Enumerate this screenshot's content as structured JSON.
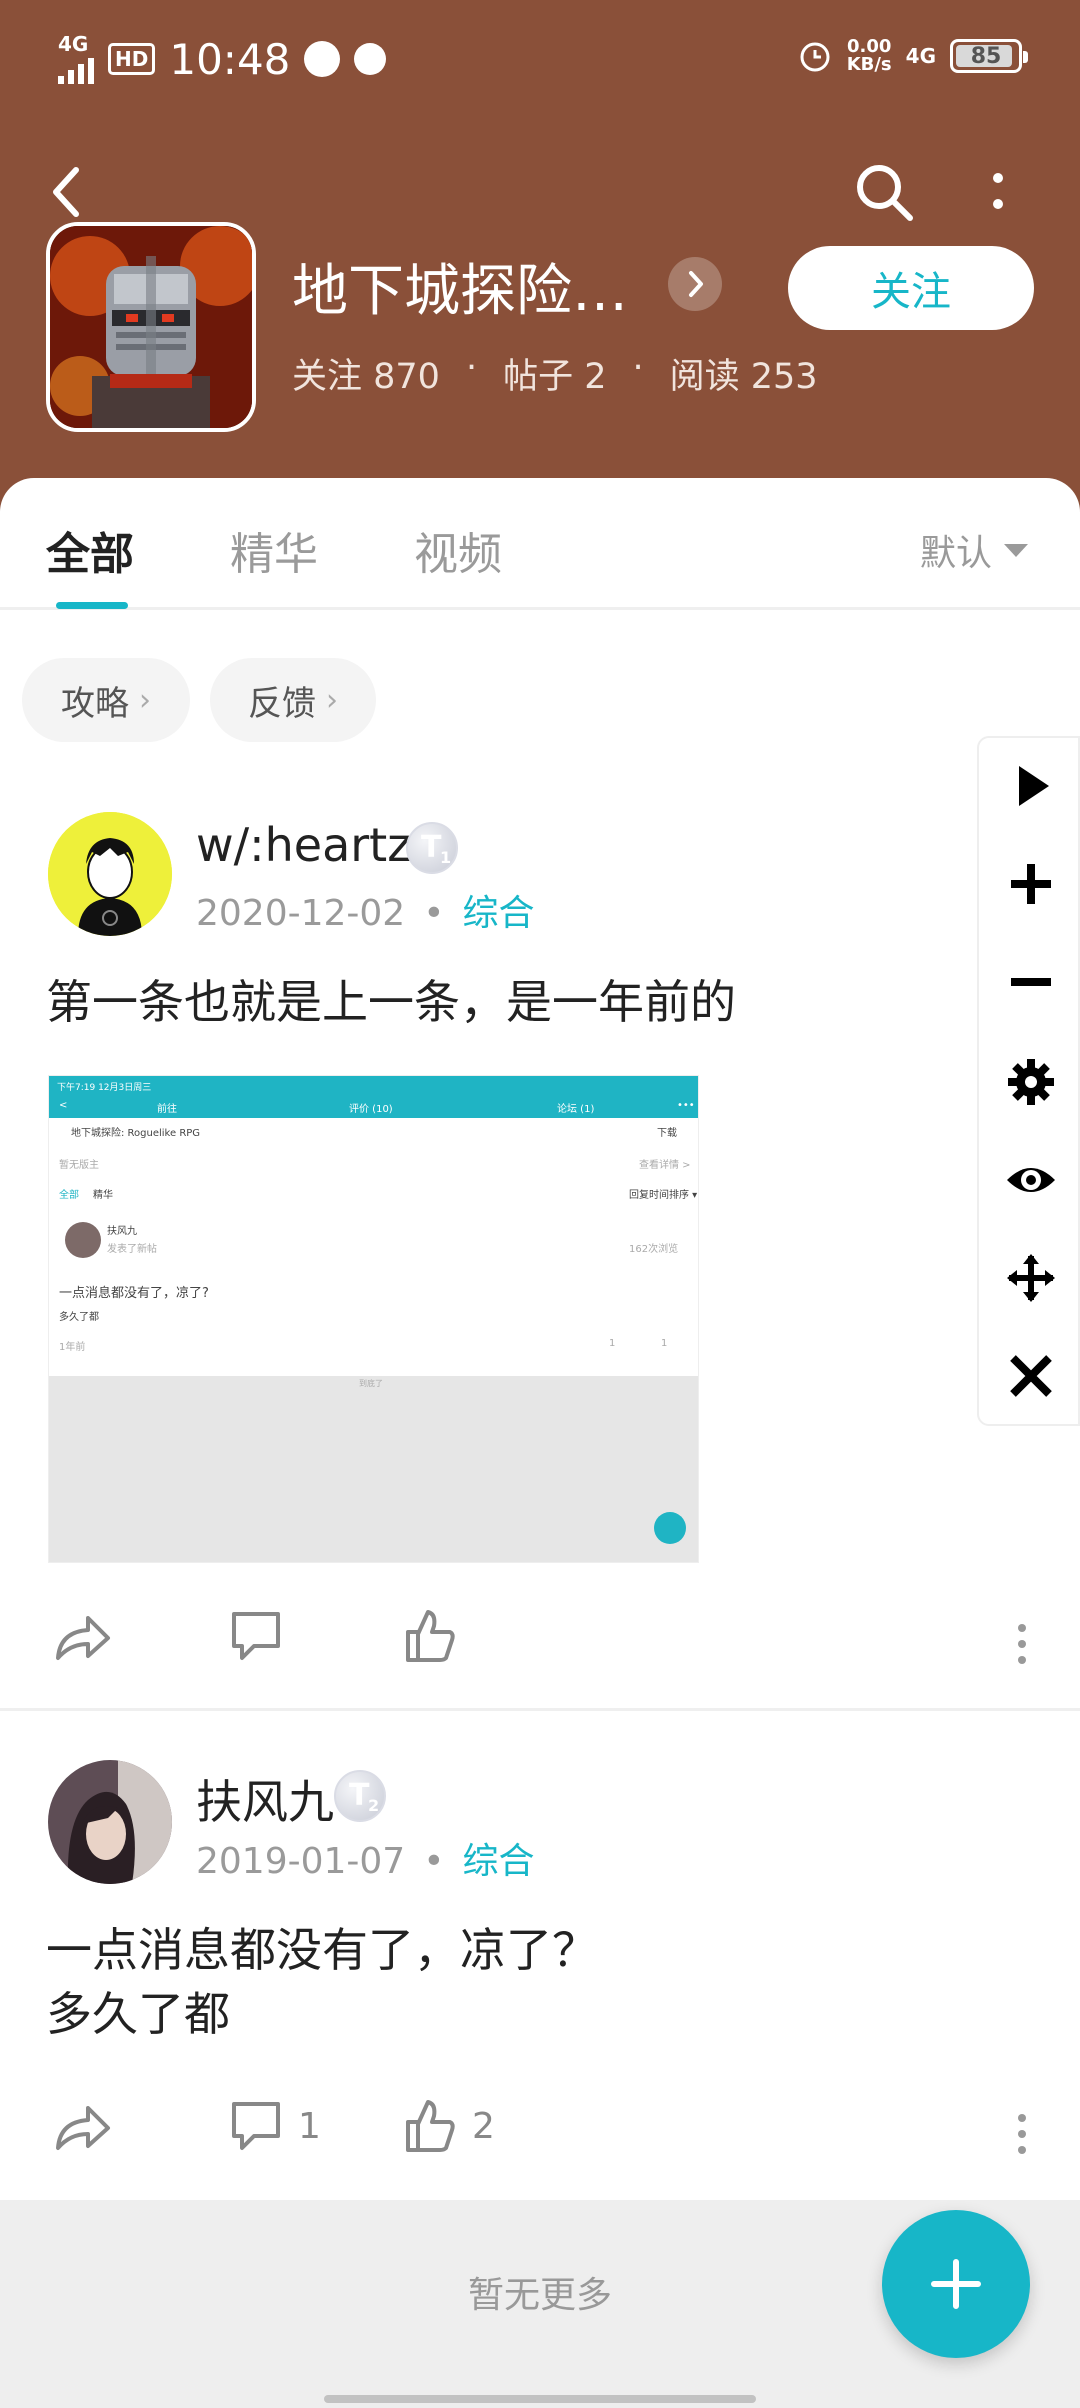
{
  "status_bar": {
    "network": "4G",
    "hd": "HD",
    "time": "10:48",
    "net_speed_value": "0.00",
    "net_speed_unit": "KB/s",
    "network_right": "4G",
    "battery": "85"
  },
  "forum": {
    "title": "地下城探险…",
    "follow_label": "关注",
    "stats": {
      "followers_label": "关注 870",
      "posts_label": "帖子 2",
      "reads_label": "阅读 253",
      "separator": "·"
    }
  },
  "tabs": [
    {
      "label": "全部",
      "active": true
    },
    {
      "label": "精华",
      "active": false
    },
    {
      "label": "视频",
      "active": false
    }
  ],
  "sort_label": "默认",
  "chips": [
    {
      "label": "攻略"
    },
    {
      "label": "反馈"
    }
  ],
  "floating_toolbar": [
    "play-icon",
    "plus-icon",
    "minus-icon",
    "gear-icon",
    "eye-icon",
    "move-icon",
    "close-icon"
  ],
  "posts": [
    {
      "author": "w/:heartz",
      "level_badge": "T",
      "level_num": "1",
      "date": "2020-12-02",
      "category": "综合",
      "body_lines": [
        "第一条也就是上一条，是一年前的"
      ],
      "comments": "",
      "likes": ""
    },
    {
      "author": "扶风九",
      "level_badge": "T",
      "level_num": "2",
      "date": "2019-01-07",
      "category": "综合",
      "body_lines": [
        "一点消息都没有了，凉了？",
        "多久了都"
      ],
      "comments": "1",
      "likes": "2"
    }
  ],
  "embedded_screenshot": {
    "status": "下午7:19 12月3日周三",
    "tab_left": "前往",
    "tab_mid": "评价 (10)",
    "tab_right": "论坛 (1)",
    "game_name": "地下城探险: Roguelike RPG",
    "download": "下载",
    "mod_line": "暂无版主",
    "more_detail": "查看详情 >",
    "tab_all": "全部",
    "tab_best": "精华",
    "sort": "回复时间排序 ▾",
    "author": "扶风九",
    "action": "发表了新帖",
    "views": "162次浏览",
    "title": "一点消息都没有了，凉了?",
    "body": "多久了都",
    "time_ago": "1年前",
    "likes": "1",
    "comments": "1",
    "end_note": "到底了"
  },
  "footer_text": "暂无更多",
  "colors": {
    "header_bg": "#8a5039",
    "accent": "#17b6c8"
  }
}
